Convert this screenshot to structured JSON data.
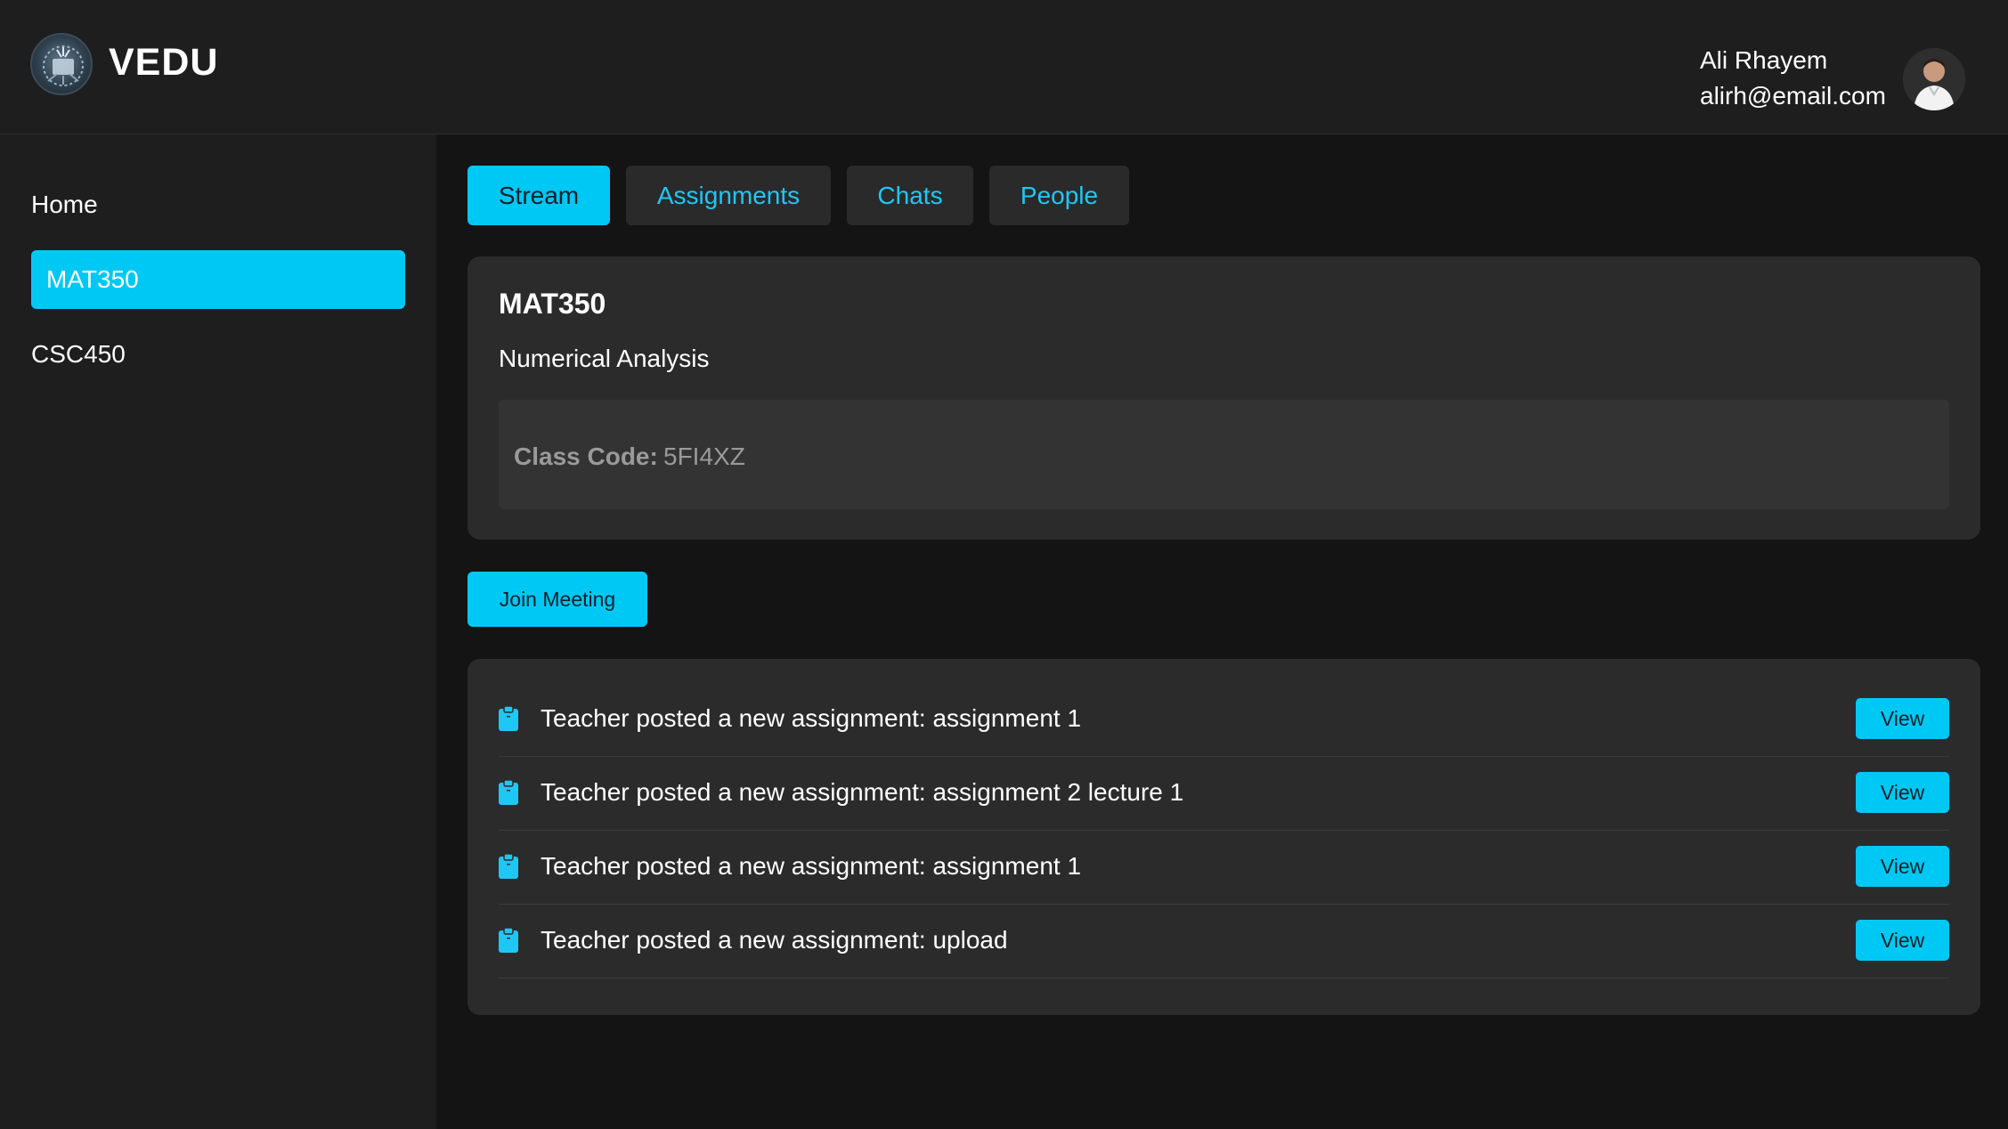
{
  "app": {
    "brand": "VEDU"
  },
  "user": {
    "name": "Ali Rhayem",
    "email": "alirh@email.com"
  },
  "sidebar": {
    "items": [
      {
        "label": "Home"
      },
      {
        "label": "MAT350",
        "active": true
      },
      {
        "label": "CSC450"
      }
    ]
  },
  "tabs": [
    {
      "label": "Stream",
      "active": true
    },
    {
      "label": "Assignments"
    },
    {
      "label": "Chats"
    },
    {
      "label": "People"
    }
  ],
  "course": {
    "code": "MAT350",
    "name": "Numerical Analysis",
    "class_code_label": "Class Code:",
    "class_code": "5FI4XZ"
  },
  "actions": {
    "join_meeting": "Join Meeting"
  },
  "stream": {
    "items": [
      {
        "text": "Teacher posted a new assignment: assignment 1",
        "button": "View",
        "icon": "clipboard-icon"
      },
      {
        "text": "Teacher posted a new assignment: assignment 2 lecture 1",
        "button": "View",
        "icon": "clipboard-icon"
      },
      {
        "text": "Teacher posted a new assignment: assignment 1",
        "button": "View",
        "icon": "clipboard-icon"
      },
      {
        "text": "Teacher posted a new assignment: upload",
        "button": "View",
        "icon": "clipboard-icon"
      }
    ]
  },
  "colors": {
    "accent": "#00c8f5",
    "background": "#141414",
    "panel": "#1e1e1e",
    "card": "#2b2b2b"
  }
}
